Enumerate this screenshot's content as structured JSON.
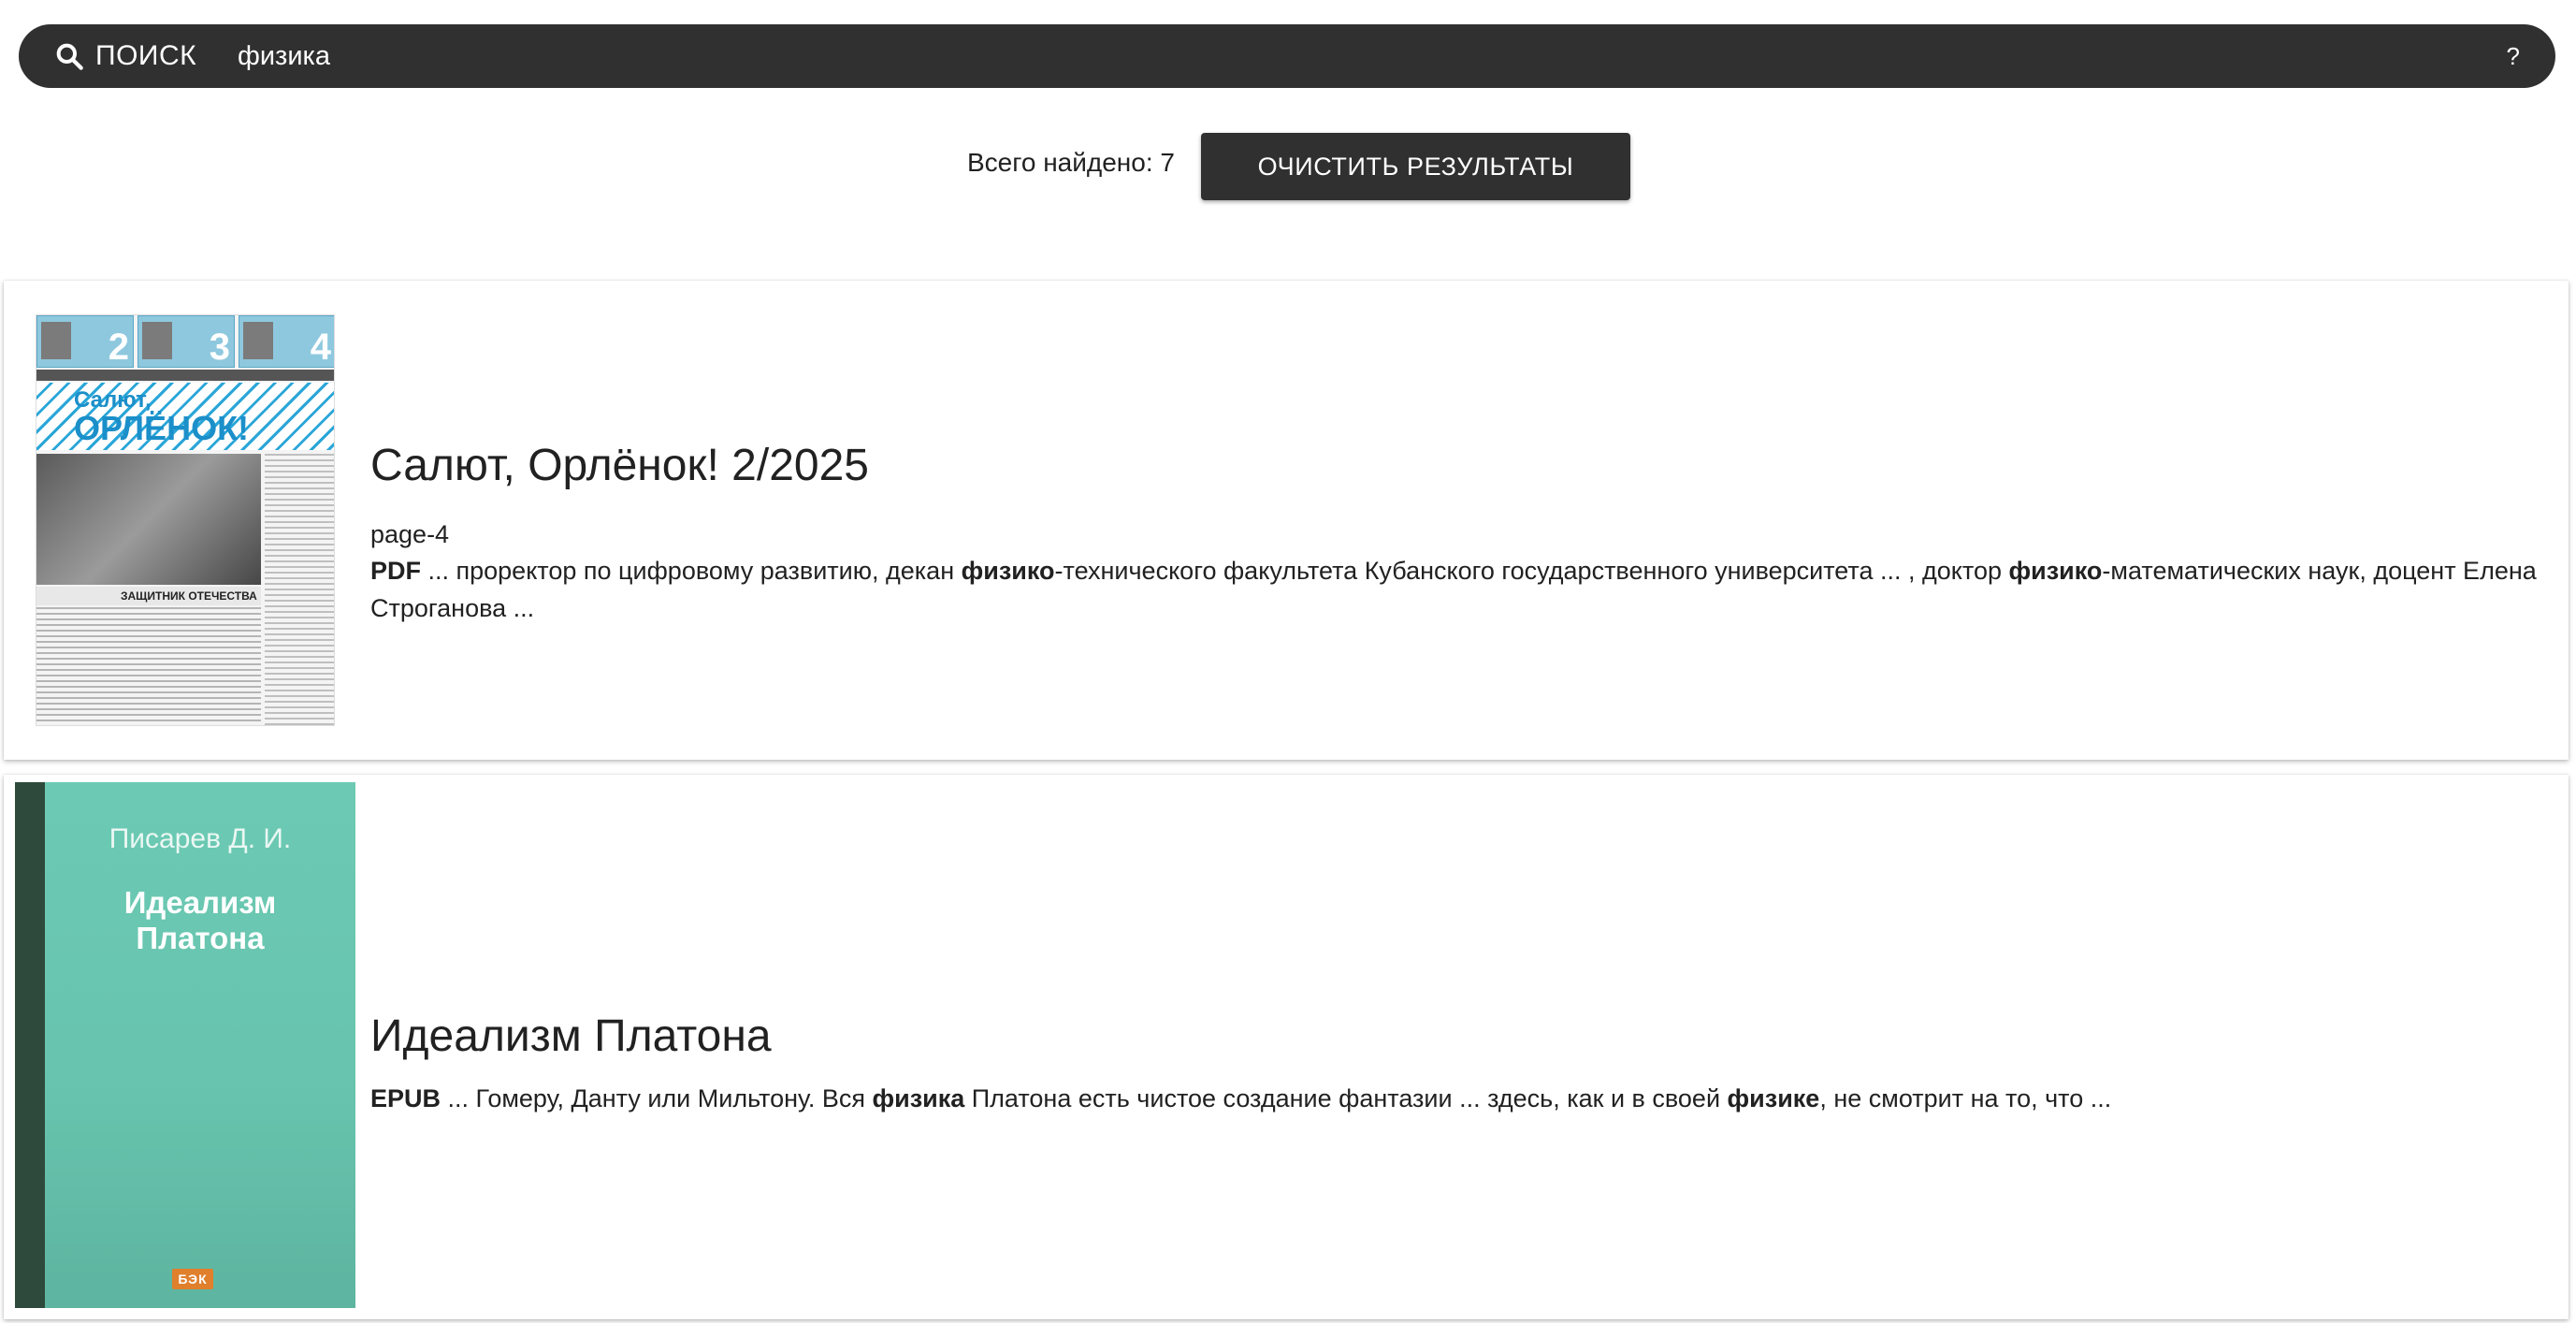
{
  "search": {
    "label": "ПОИСК",
    "query": "физика",
    "help_label": "?"
  },
  "results_header": {
    "total_label": "Всего найдено: 7",
    "clear_button": "ОЧИСТИТЬ РЕЗУЛЬТАТЫ"
  },
  "results": [
    {
      "title": "Салют, Орлёнок! 2/2025",
      "page": "page-4",
      "format": "PDF",
      "snippet_parts": [
        " ... проректор по цифровому развитию, декан ",
        "физико",
        "-технического факультета Кубанского государственного университета ... , доктор ",
        "физико",
        "-математических наук, доцент Елена Строганова ..."
      ],
      "cover": {
        "masthead_line1": "Салют,",
        "masthead_line2": "ОРЛЁНОК!",
        "section": "ЗАЩИТНИК ОТЕЧЕСТВА",
        "pages": [
          "2",
          "3",
          "4"
        ]
      }
    },
    {
      "title": "Идеализм Платона",
      "format": "EPUB",
      "snippet_parts": [
        " ... Гомеру, Данту или Мильтону. Вся ",
        "физика",
        " Платона есть чистое создание фантазии ... здесь, как и в своей ",
        "физике",
        ", не смотрит на то, что ..."
      ],
      "cover": {
        "author": "Писарев Д. И.",
        "title_line1": "Идеализм",
        "title_line2": "Платона",
        "publisher": "БЭК"
      }
    }
  ]
}
